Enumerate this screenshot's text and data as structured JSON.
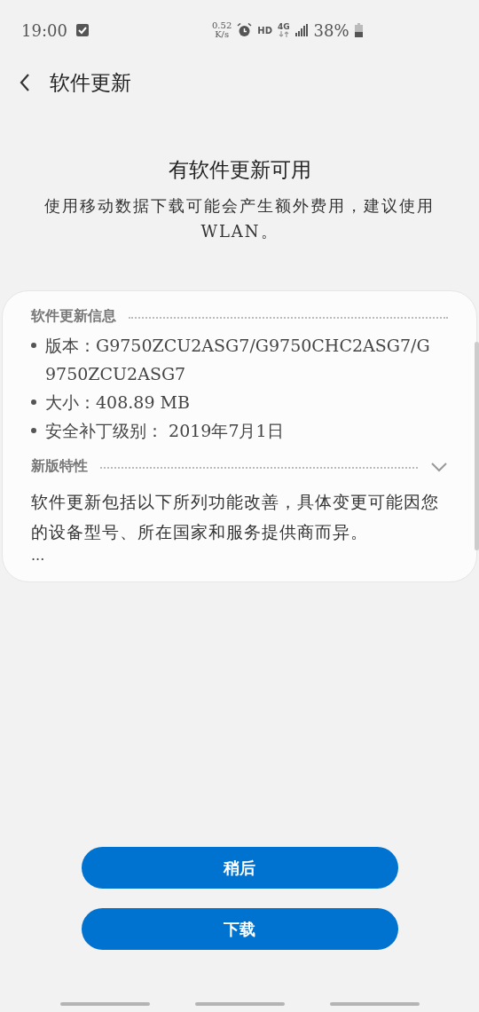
{
  "status_bar": {
    "time": "19:00",
    "net_speed_value": "0.52",
    "net_speed_unit": "K/s",
    "hd": "HD",
    "network": "4G",
    "battery": "38%"
  },
  "header": {
    "title": "软件更新"
  },
  "notice": {
    "title": "有软件更新可用",
    "message": "使用移动数据下载可能会产生额外费用，建议使用 WLAN。"
  },
  "card": {
    "info_heading": "软件更新信息",
    "info_items": [
      {
        "text": "版本：G9750ZCU2ASG7/G9750CHC2ASG7/G9750ZCU2ASG7"
      },
      {
        "text": "大小：408.89 MB"
      },
      {
        "text": "安全补丁级别： 2019年7月1日"
      }
    ],
    "features": {
      "heading": "新版特性",
      "expanded": false,
      "text": "软件更新包括以下所列功能改善，具体变更可能因您的设备型号、所在国家和服务提供商而异。",
      "more": "..."
    }
  },
  "buttons": [
    {
      "label": "稍后"
    },
    {
      "label": "下载"
    }
  ]
}
